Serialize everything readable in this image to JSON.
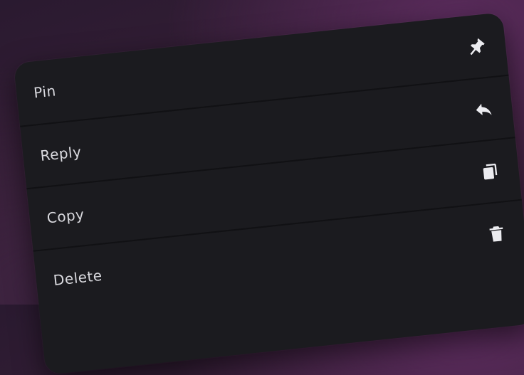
{
  "menu": {
    "items": [
      {
        "label": "Pin",
        "icon": "pin-icon"
      },
      {
        "label": "Reply",
        "icon": "reply-icon"
      },
      {
        "label": "Copy",
        "icon": "copy-icon"
      },
      {
        "label": "Delete",
        "icon": "trash-icon"
      }
    ]
  },
  "colors": {
    "menu_background": "#1b1b1f",
    "text": "#d9d9de",
    "icon": "#ececf0",
    "backdrop": "#3a2038"
  }
}
